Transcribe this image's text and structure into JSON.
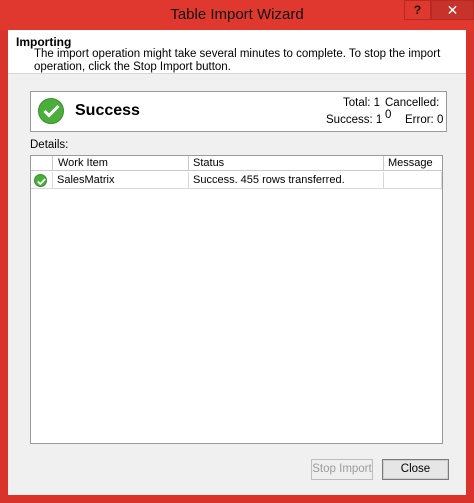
{
  "window": {
    "title": "Table Import Wizard",
    "help_label": "?",
    "close_label": "✕"
  },
  "header": {
    "title": "Importing",
    "description": "The import operation might take several minutes to complete. To stop the import operation, click the Stop Import button."
  },
  "status": {
    "icon": "success-check-icon",
    "label": "Success",
    "total": "Total: 1",
    "cancelled": "Cancelled: 0",
    "success": "Success: 1",
    "error": "Error: 0"
  },
  "details": {
    "label": "Details:",
    "columns": [
      "",
      "Work Item",
      "Status",
      "Message"
    ],
    "rows": [
      {
        "icon": "success-check-icon",
        "work_item": "SalesMatrix",
        "status": "Success. 455 rows transferred.",
        "message": ""
      }
    ]
  },
  "buttons": {
    "stop_import": "Stop Import",
    "close": "Close"
  },
  "colors": {
    "title_bar": "#e0382e",
    "success_green": "#4bae3a"
  }
}
